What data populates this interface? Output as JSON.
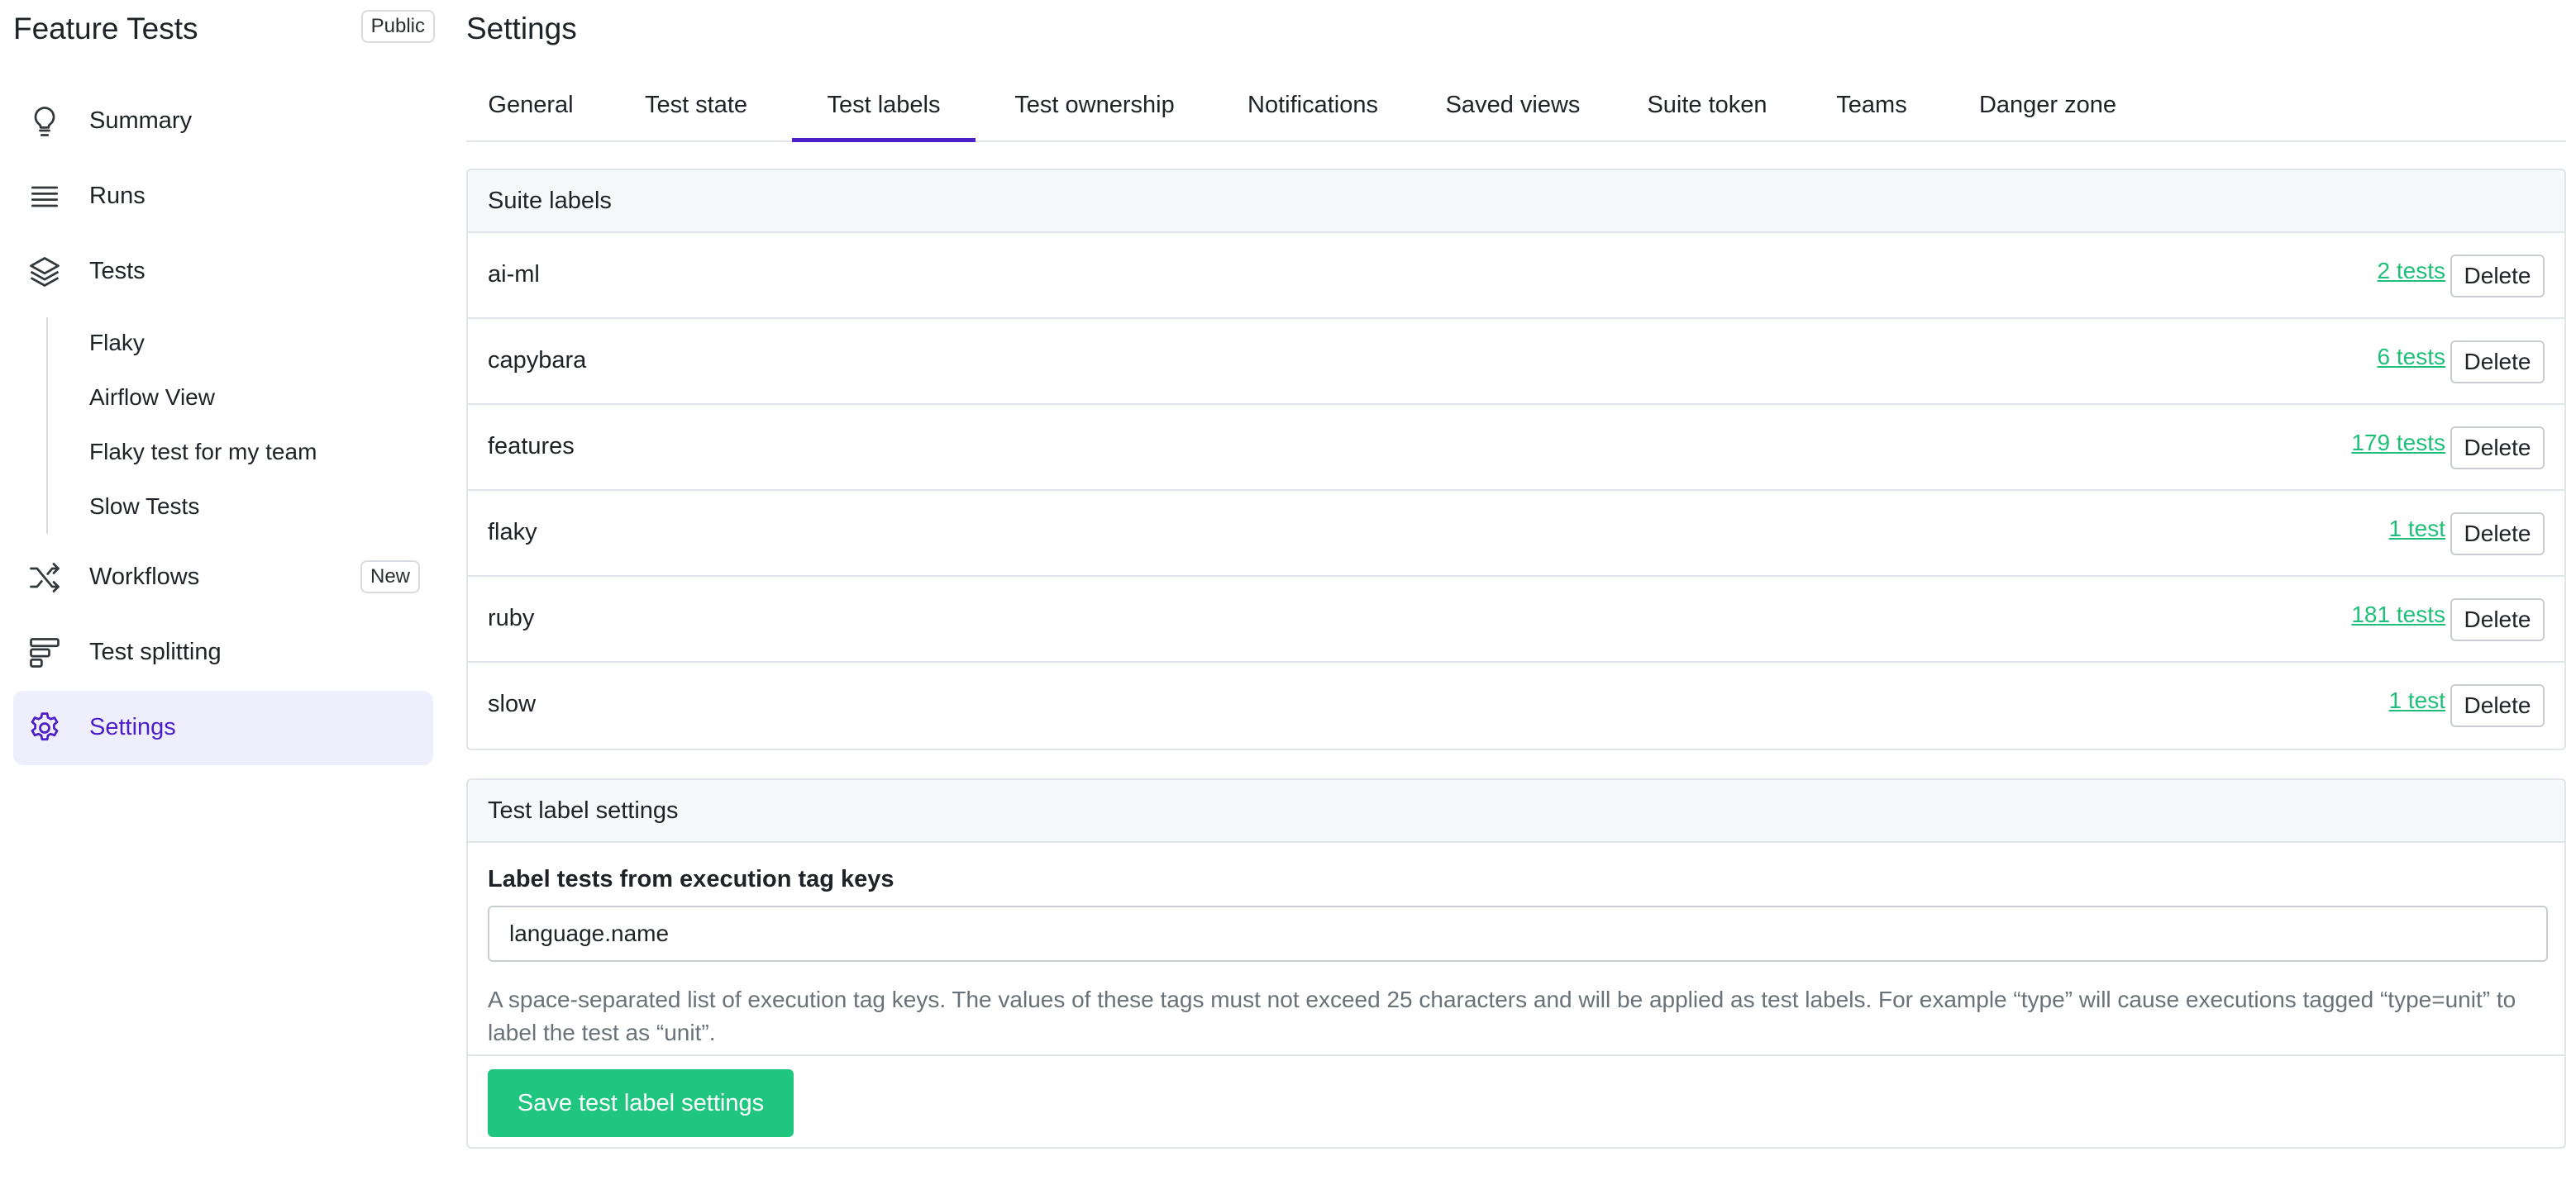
{
  "sidebar": {
    "suite_title": "Feature Tests",
    "visibility_badge": "Public",
    "nav": {
      "summary": "Summary",
      "runs": "Runs",
      "tests": "Tests",
      "workflows": "Workflows",
      "workflows_badge": "New",
      "test_splitting": "Test splitting",
      "settings": "Settings"
    },
    "saved_views": [
      "Flaky",
      "Airflow View",
      "Flaky test for my team",
      "Slow Tests"
    ]
  },
  "main": {
    "page_title": "Settings",
    "tabs": [
      "General",
      "Test state",
      "Test labels",
      "Test ownership",
      "Notifications",
      "Saved views",
      "Suite token",
      "Teams",
      "Danger zone"
    ],
    "active_tab": "Test labels"
  },
  "suite_labels": {
    "header": "Suite labels",
    "delete_label": "Delete",
    "rows": [
      {
        "name": "ai-ml",
        "count": "2 tests"
      },
      {
        "name": "capybara",
        "count": "6 tests"
      },
      {
        "name": "features",
        "count": "179 tests"
      },
      {
        "name": "flaky",
        "count": "1 test"
      },
      {
        "name": "ruby",
        "count": "181 tests"
      },
      {
        "name": "slow",
        "count": "1 test"
      }
    ]
  },
  "label_settings": {
    "header": "Test label settings",
    "field_label": "Label tests from execution tag keys",
    "input_value": "language.name",
    "help_text": "A space-separated list of execution tag keys. The values of these tags must not exceed 25 characters and will be applied as test labels. For example “type” will cause executions tagged “type=unit” to label the test as “unit”.",
    "save_label": "Save test label settings"
  },
  "colors": {
    "accent": "#4c1fc9",
    "active_bg": "#efeefd",
    "link_green": "#1fbf7a",
    "save_green": "#20c67f"
  }
}
